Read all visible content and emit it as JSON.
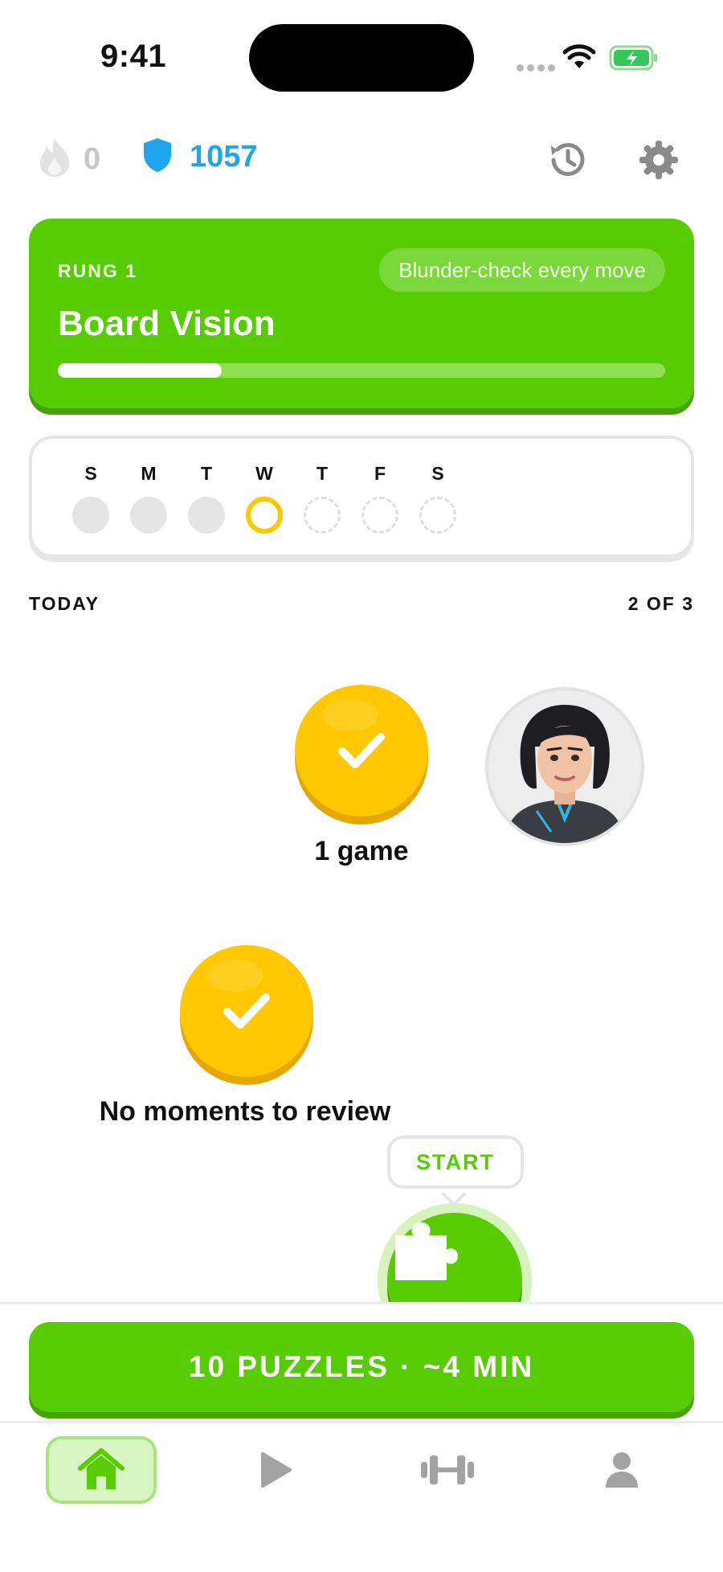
{
  "status_bar": {
    "time": "9:41"
  },
  "header": {
    "streak_count": "0",
    "rating": "1057",
    "icons": [
      "flame-icon",
      "shield-icon",
      "history-icon",
      "gear-icon"
    ]
  },
  "rung": {
    "label": "RUNG 1",
    "tip": "Blunder-check every move",
    "title": "Board Vision",
    "progress_fraction": 0.27
  },
  "week": {
    "days": [
      "S",
      "M",
      "T",
      "W",
      "T",
      "F",
      "S"
    ],
    "states": [
      "done",
      "done",
      "done",
      "today",
      "future",
      "future",
      "future"
    ]
  },
  "today": {
    "label": "TODAY",
    "count": "2 OF 3"
  },
  "path": {
    "node1_label": "1 game",
    "node2_label": "No moments to review",
    "start_label": "START"
  },
  "cta": {
    "label": "10 PUZZLES · ~4 MIN"
  },
  "tabs": [
    {
      "name": "home",
      "icon": "home-icon",
      "active": true
    },
    {
      "name": "play",
      "icon": "play-icon",
      "active": false
    },
    {
      "name": "train",
      "icon": "dumbbell-icon",
      "active": false
    },
    {
      "name": "profile",
      "icon": "person-icon",
      "active": false
    }
  ],
  "colors": {
    "brand_green": "#58cc02",
    "gold": "#ffc800",
    "rating_blue": "#1fa5ee"
  }
}
